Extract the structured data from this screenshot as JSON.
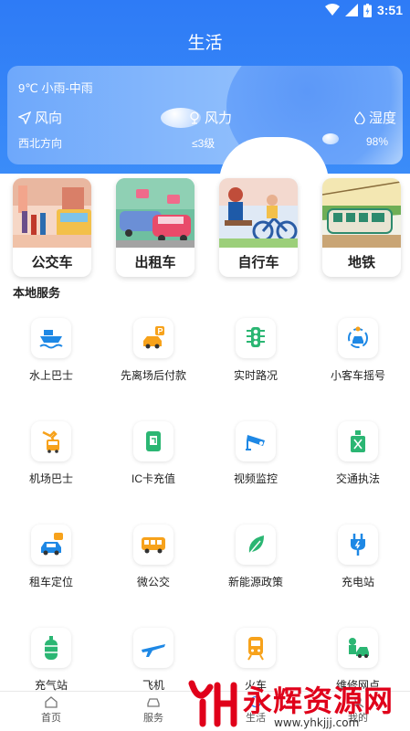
{
  "status_bar": {
    "time": "3:51"
  },
  "header": {
    "title": "生活"
  },
  "weather": {
    "summary": "9℃  小雨-中雨",
    "wind_direction_label": "风向",
    "wind_direction_value": "西北方向",
    "wind_power_label": "风力",
    "wind_power_value": "≤3级",
    "humidity_label": "湿度",
    "humidity_value": "98%"
  },
  "modes": [
    {
      "label": "公交车"
    },
    {
      "label": "出租车"
    },
    {
      "label": "自行车"
    },
    {
      "label": "地铁"
    }
  ],
  "local_services": {
    "title": "本地服务",
    "items": [
      {
        "label": "水上巴士",
        "icon": "ship-icon"
      },
      {
        "label": "先离场后付款",
        "icon": "parking-car-icon"
      },
      {
        "label": "实时路况",
        "icon": "traffic-light-icon"
      },
      {
        "label": "小客车摇号",
        "icon": "car-lottery-icon"
      },
      {
        "label": "机场巴士",
        "icon": "airport-bus-icon"
      },
      {
        "label": "IC卡充值",
        "icon": "ic-card-icon"
      },
      {
        "label": "视频监控",
        "icon": "camera-icon"
      },
      {
        "label": "交通执法",
        "icon": "enforcement-icon"
      },
      {
        "label": "租车定位",
        "icon": "rental-car-icon"
      },
      {
        "label": "微公交",
        "icon": "minibus-icon"
      },
      {
        "label": "新能源政策",
        "icon": "leaf-icon"
      },
      {
        "label": "充电站",
        "icon": "charging-plug-icon"
      },
      {
        "label": "充气站",
        "icon": "gas-tank-icon"
      },
      {
        "label": "飞机",
        "icon": "airplane-icon"
      },
      {
        "label": "火车",
        "icon": "train-icon"
      },
      {
        "label": "维修网点",
        "icon": "repair-icon"
      }
    ]
  },
  "bottom_nav": [
    {
      "label": "首页",
      "icon": "home-icon"
    },
    {
      "label": "服务",
      "icon": "service-icon"
    },
    {
      "label": "生活",
      "icon": "life-icon"
    },
    {
      "label": "我的",
      "icon": "profile-icon"
    }
  ],
  "watermark": {
    "text": "永辉资源网",
    "url": "www.yhkjjj.com"
  },
  "colors": {
    "primary": "#2e7bf6",
    "accent_orange": "#f7a21b",
    "accent_green": "#2bb673",
    "accent_blue": "#1e88e5"
  }
}
